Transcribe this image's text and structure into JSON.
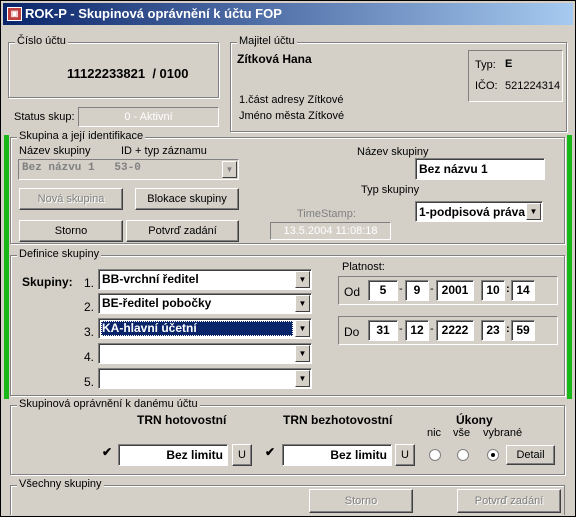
{
  "window": {
    "title": "ROK-P - Skupinová oprávnění k účtu  FOP",
    "icon_text": "▣"
  },
  "account": {
    "group_label": "Číslo účtu",
    "number": "11122233821  / 0100"
  },
  "owner": {
    "group_label": "Majitel účtu",
    "name": "Zítková Hana",
    "address1": "1.část adresy Zítkové",
    "address2": "Jméno města Zítkové",
    "type_label": "Typ:",
    "type_value": "E",
    "ico_label": "IČO:",
    "ico_value": "521224314"
  },
  "status": {
    "label": "Status skup:",
    "value": "0 - Aktivní"
  },
  "group_ident": {
    "group_label": "Skupina a její identifikace",
    "col_name": "Název skupiny",
    "col_id": "ID + typ záznamu",
    "combo_value": "Bez názvu 1   53-0",
    "new_group": "Nová skupina",
    "block_group": "Blokace skupiny",
    "cancel": "Storno",
    "confirm": "Potvrď zadání",
    "timestamp_label": "TimeStamp:",
    "timestamp_value": "13.5.2004 11:08:18",
    "name_label": "Název skupiny",
    "name_value": "Bez názvu 1",
    "type_label": "Typ skupiny",
    "type_value": "1-podpisová práva"
  },
  "definition": {
    "group_label": "Definice skupiny",
    "groups_label": "Skupiny:",
    "rows": [
      {
        "num": "1.",
        "value": "BB-vrchní ředitel"
      },
      {
        "num": "2.",
        "value": "BE-ředitel pobočky"
      },
      {
        "num": "3.",
        "value": "KA-hlavní účetní"
      },
      {
        "num": "4.",
        "value": ""
      },
      {
        "num": "5.",
        "value": ""
      }
    ],
    "validity_label": "Platnost:",
    "from_label": "Od",
    "from": {
      "d": "5",
      "m": "9",
      "y": "2001",
      "h": "10",
      "min": "14"
    },
    "to_label": "Do",
    "to": {
      "d": "31",
      "m": "12",
      "y": "2222",
      "h": "23",
      "min": "59"
    },
    "sep_dash": "-",
    "sep_colon": ":"
  },
  "permissions": {
    "group_label": "Skupinová oprávnění k danému účtu",
    "cash_label": "TRN hotovostní",
    "cash_value": "Bez limitu",
    "noncash_label": "TRN bezhotovostní",
    "noncash_value": "Bez limitu",
    "u_button": "U",
    "actions_label": "Úkony",
    "opt_none": "nic",
    "opt_all": "vše",
    "opt_selected": "vybrané",
    "detail_button": "Detail",
    "check_mark": "✔"
  },
  "all_groups": {
    "group_label": "Všechny skupiny",
    "cancel": "Storno",
    "confirm": "Potvrď zadání"
  },
  "icons": {
    "dropdown": "▼",
    "minimize": "_",
    "maximize": "□",
    "close": "×"
  },
  "colors": {
    "accent_green": "#18b818",
    "selection": "#0a246a",
    "titlebar": "#0a246a"
  }
}
